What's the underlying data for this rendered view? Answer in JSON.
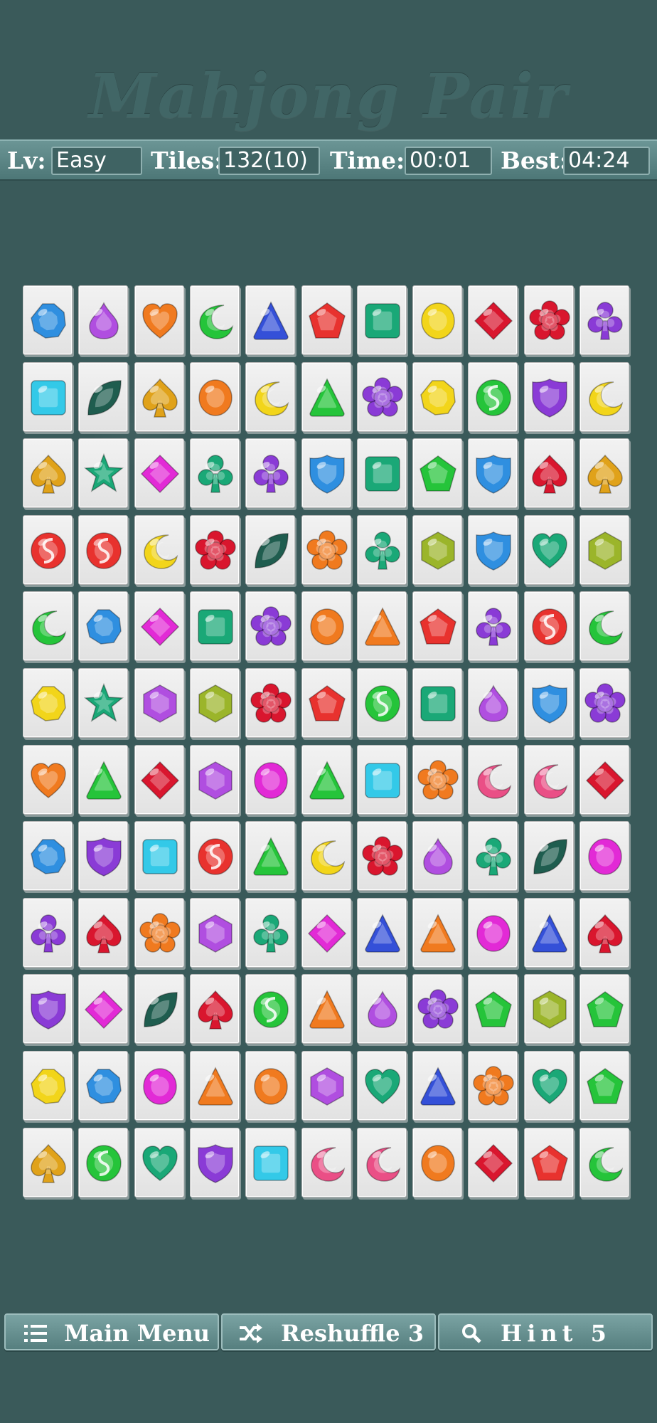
{
  "header": {
    "title": "Mahjong Pair"
  },
  "status": {
    "level_label": "Lv:",
    "level_value": "Easy",
    "tiles_label": "Tiles:",
    "tiles_value": "132(10)",
    "time_label": "Time:",
    "time_value": "00:01",
    "best_label": "Best:",
    "best_value": "04:24"
  },
  "colors": {
    "blue": "#2f8fe0",
    "cyan": "#33c9e8",
    "purple": "#8a3bd6",
    "orange": "#f07a1f",
    "green": "#25c43a",
    "teal": "#1aa877",
    "red": "#e8322e",
    "yellow": "#f2d51a",
    "magenta": "#e22ad6",
    "gold": "#e0a21a",
    "pink": "#ea4f86",
    "olive": "#9bb52a",
    "dark": "#1f5d4f",
    "royal": "#3450d8",
    "violet": "#b04ee0",
    "crimson": "#d9162e"
  },
  "board": {
    "rows": [
      [
        [
          "octagon",
          "blue"
        ],
        [
          "drop",
          "violet"
        ],
        [
          "heart",
          "orange"
        ],
        [
          "moon",
          "green"
        ],
        [
          "triangle",
          "royal"
        ],
        [
          "pentagon",
          "red"
        ],
        [
          "square",
          "teal"
        ],
        [
          "circle",
          "yellow"
        ],
        [
          "diamond",
          "crimson"
        ],
        [
          "flower",
          "crimson"
        ],
        [
          "club",
          "purple"
        ]
      ],
      [
        [
          "square",
          "cyan"
        ],
        [
          "leaf",
          "dark"
        ],
        [
          "spade",
          "gold"
        ],
        [
          "circle",
          "orange"
        ],
        [
          "moon",
          "yellow"
        ],
        [
          "triangle",
          "green"
        ],
        [
          "flower",
          "purple"
        ],
        [
          "octagon",
          "yellow"
        ],
        [
          "swirl",
          "green"
        ],
        [
          "shield",
          "purple"
        ],
        [
          "moon",
          "yellow"
        ]
      ],
      [
        [
          "spade",
          "gold"
        ],
        [
          "star",
          "teal"
        ],
        [
          "diamond",
          "magenta"
        ],
        [
          "club",
          "teal"
        ],
        [
          "club",
          "purple"
        ],
        [
          "shield",
          "blue"
        ],
        [
          "square",
          "teal"
        ],
        [
          "pentagon",
          "green"
        ],
        [
          "shield",
          "blue"
        ],
        [
          "spade",
          "crimson"
        ],
        [
          "spade",
          "gold"
        ]
      ],
      [
        [
          "swirl",
          "red"
        ],
        [
          "swirl",
          "red"
        ],
        [
          "moon",
          "yellow"
        ],
        [
          "flower",
          "crimson"
        ],
        [
          "leaf",
          "dark"
        ],
        [
          "flower",
          "orange"
        ],
        [
          "club",
          "teal"
        ],
        [
          "hexagon",
          "olive"
        ],
        [
          "shield",
          "blue"
        ],
        [
          "heart",
          "teal"
        ],
        [
          "hexagon",
          "olive"
        ]
      ],
      [
        [
          "moon",
          "green"
        ],
        [
          "octagon",
          "blue"
        ],
        [
          "diamond",
          "magenta"
        ],
        [
          "square",
          "teal"
        ],
        [
          "flower",
          "purple"
        ],
        [
          "circle",
          "orange"
        ],
        [
          "triangle",
          "orange"
        ],
        [
          "pentagon",
          "red"
        ],
        [
          "club",
          "purple"
        ],
        [
          "swirl",
          "red"
        ],
        [
          "moon",
          "green"
        ]
      ],
      [
        [
          "octagon",
          "yellow"
        ],
        [
          "star",
          "teal"
        ],
        [
          "hexagon",
          "violet"
        ],
        [
          "hexagon",
          "olive"
        ],
        [
          "flower",
          "crimson"
        ],
        [
          "pentagon",
          "red"
        ],
        [
          "swirl",
          "green"
        ],
        [
          "square",
          "teal"
        ],
        [
          "drop",
          "violet"
        ],
        [
          "shield",
          "blue"
        ],
        [
          "flower",
          "purple"
        ]
      ],
      [
        [
          "heart",
          "orange"
        ],
        [
          "triangle",
          "green"
        ],
        [
          "diamond",
          "crimson"
        ],
        [
          "hexagon",
          "violet"
        ],
        [
          "circle",
          "magenta"
        ],
        [
          "triangle",
          "green"
        ],
        [
          "square",
          "cyan"
        ],
        [
          "flower",
          "orange"
        ],
        [
          "moon",
          "pink"
        ],
        [
          "moon",
          "pink"
        ],
        [
          "diamond",
          "crimson"
        ]
      ],
      [
        [
          "octagon",
          "blue"
        ],
        [
          "shield",
          "purple"
        ],
        [
          "square",
          "cyan"
        ],
        [
          "swirl",
          "red"
        ],
        [
          "triangle",
          "green"
        ],
        [
          "moon",
          "yellow"
        ],
        [
          "flower",
          "crimson"
        ],
        [
          "drop",
          "violet"
        ],
        [
          "club",
          "teal"
        ],
        [
          "leaf",
          "dark"
        ],
        [
          "circle",
          "magenta"
        ]
      ],
      [
        [
          "club",
          "purple"
        ],
        [
          "spade",
          "crimson"
        ],
        [
          "flower",
          "orange"
        ],
        [
          "hexagon",
          "violet"
        ],
        [
          "club",
          "teal"
        ],
        [
          "diamond",
          "magenta"
        ],
        [
          "triangle",
          "royal"
        ],
        [
          "triangle",
          "orange"
        ],
        [
          "circle",
          "magenta"
        ],
        [
          "triangle",
          "royal"
        ],
        [
          "spade",
          "crimson"
        ]
      ],
      [
        [
          "shield",
          "purple"
        ],
        [
          "diamond",
          "magenta"
        ],
        [
          "leaf",
          "dark"
        ],
        [
          "spade",
          "crimson"
        ],
        [
          "swirl",
          "green"
        ],
        [
          "triangle",
          "orange"
        ],
        [
          "drop",
          "violet"
        ],
        [
          "flower",
          "purple"
        ],
        [
          "pentagon",
          "green"
        ],
        [
          "hexagon",
          "olive"
        ],
        [
          "pentagon",
          "green"
        ]
      ],
      [
        [
          "octagon",
          "yellow"
        ],
        [
          "octagon",
          "blue"
        ],
        [
          "circle",
          "magenta"
        ],
        [
          "triangle",
          "orange"
        ],
        [
          "circle",
          "orange"
        ],
        [
          "hexagon",
          "violet"
        ],
        [
          "heart",
          "teal"
        ],
        [
          "triangle",
          "royal"
        ],
        [
          "flower",
          "orange"
        ],
        [
          "heart",
          "teal"
        ],
        [
          "pentagon",
          "green"
        ]
      ],
      [
        [
          "spade",
          "gold"
        ],
        [
          "swirl",
          "green"
        ],
        [
          "heart",
          "teal"
        ],
        [
          "shield",
          "purple"
        ],
        [
          "square",
          "cyan"
        ],
        [
          "moon",
          "pink"
        ],
        [
          "moon",
          "pink"
        ],
        [
          "circle",
          "orange"
        ],
        [
          "diamond",
          "crimson"
        ],
        [
          "pentagon",
          "red"
        ],
        [
          "moon",
          "green"
        ]
      ]
    ]
  },
  "buttons": {
    "main_menu": {
      "label": "Main Menu",
      "icon": "list-icon"
    },
    "reshuffle": {
      "label": "Reshuffle 3",
      "icon": "shuffle-icon"
    },
    "hint": {
      "label": "Hint 5",
      "icon": "search-icon"
    }
  }
}
